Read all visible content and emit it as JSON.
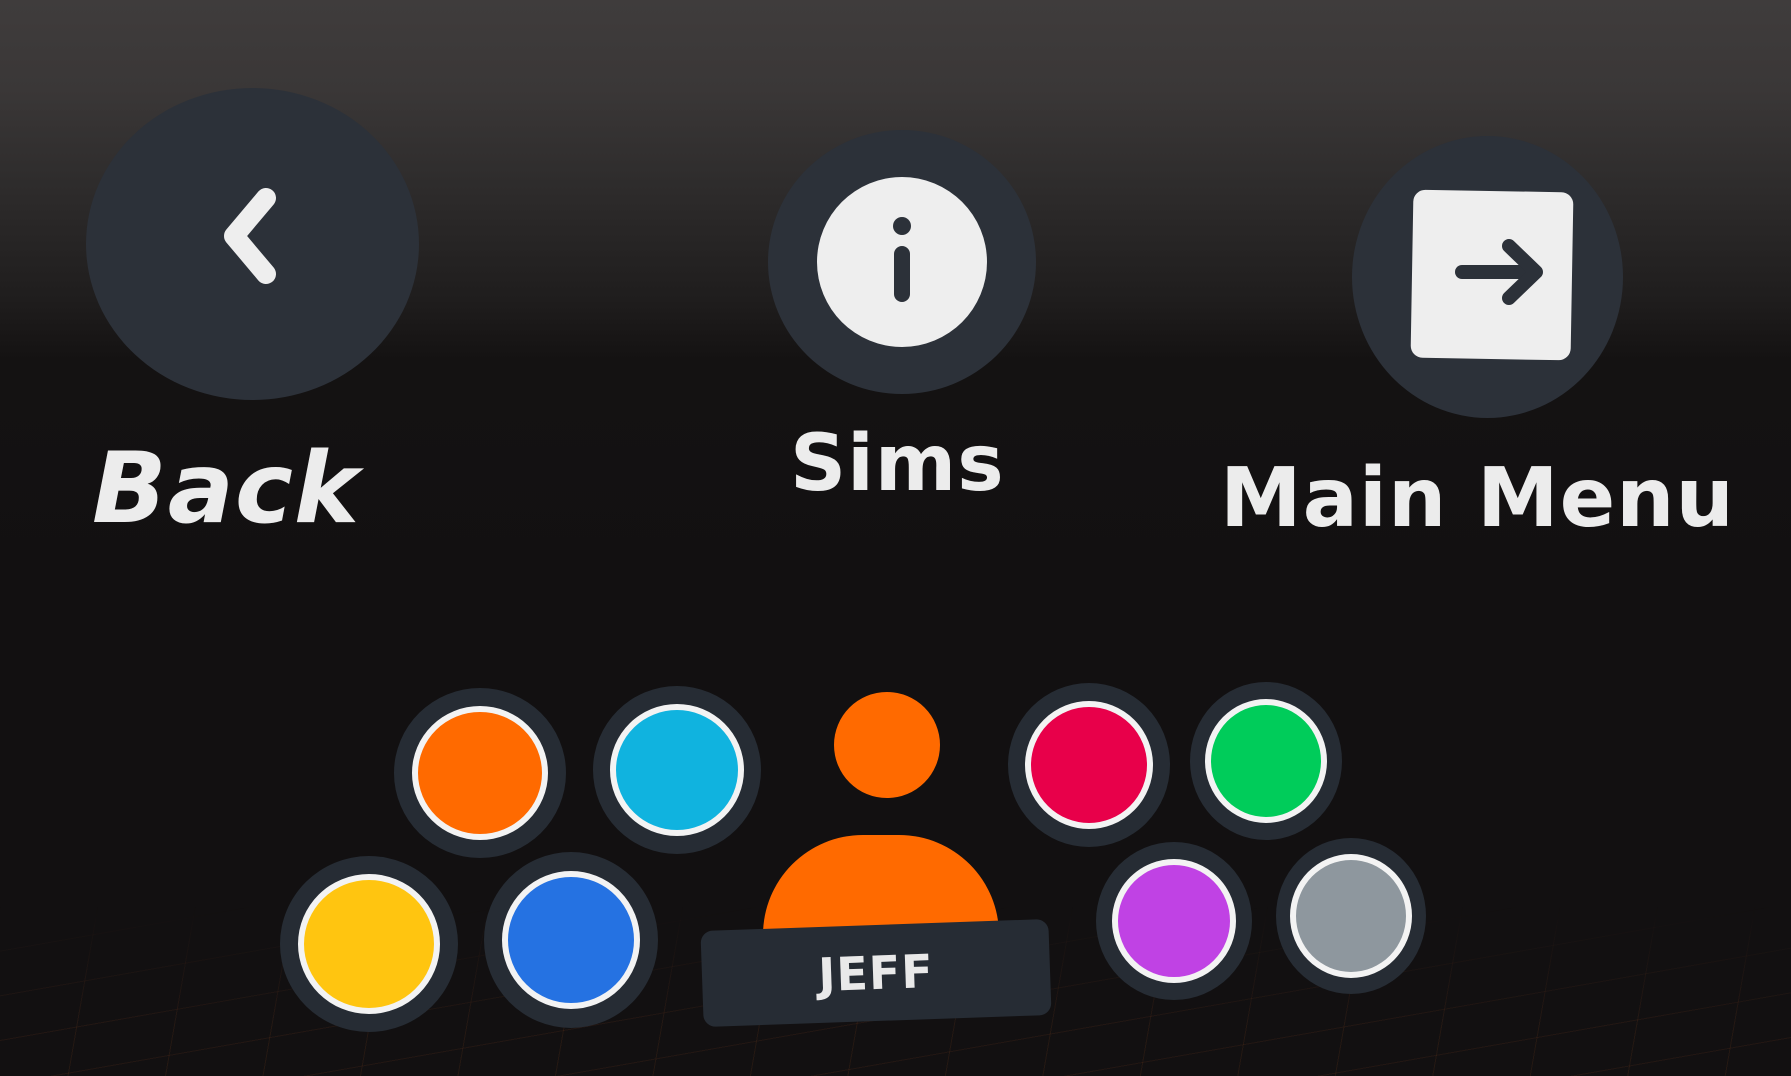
{
  "nav": {
    "back": {
      "label": "Back",
      "icon": "chevron-left-icon"
    },
    "sims": {
      "label": "Sims",
      "icon": "info-icon"
    },
    "main_menu": {
      "label": "Main Menu",
      "icon": "exit-arrow-icon"
    }
  },
  "avatar": {
    "name": "JEFF",
    "selected_color": "#ff6a00",
    "color_options": [
      {
        "name": "orange",
        "hex": "#ff6a00"
      },
      {
        "name": "cyan",
        "hex": "#10b3df"
      },
      {
        "name": "red",
        "hex": "#e8004a"
      },
      {
        "name": "green",
        "hex": "#00cc5a"
      },
      {
        "name": "yellow",
        "hex": "#ffc510"
      },
      {
        "name": "blue",
        "hex": "#2572e2"
      },
      {
        "name": "purple",
        "hex": "#c042e4"
      },
      {
        "name": "gray",
        "hex": "#8e979e"
      }
    ]
  },
  "colors": {
    "button_bg": "#2c3139",
    "swatch_ring": "#262c34",
    "label_text": "#ececec"
  }
}
